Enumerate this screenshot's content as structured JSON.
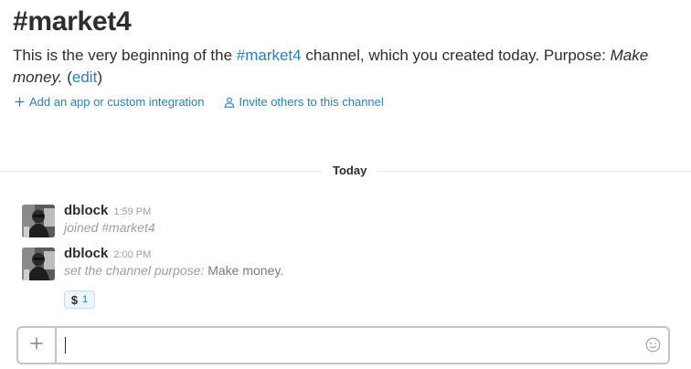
{
  "channel": {
    "title": "#market4",
    "intro_prefix": "This is the very beginning of the ",
    "intro_channel_link": "#market4",
    "intro_middle": " channel, which you created today. Purpose: ",
    "purpose": "Make money.",
    "edit_open": " (",
    "edit_label": "edit",
    "edit_close": ")"
  },
  "actions": {
    "add_integration": "Add an app or custom integration",
    "invite_others": "Invite others to this channel"
  },
  "divider": {
    "label": "Today"
  },
  "messages": [
    {
      "sender": "dblock",
      "time": "1:59 PM",
      "text": "joined #market4"
    },
    {
      "sender": "dblock",
      "time": "2:00 PM",
      "text_prefix": "set the channel purpose: ",
      "text_value": "Make money.",
      "reaction": {
        "emoji": "$",
        "count": "1"
      }
    }
  ],
  "composer": {
    "value": "",
    "placeholder": ""
  },
  "colors": {
    "link": "#2a80b9",
    "text": "#2c2d30",
    "muted": "#9e9ea6",
    "border": "#c5c5c8"
  },
  "icons": {
    "add_integration": "plus-icon",
    "invite": "person-icon",
    "composer_add": "plus-icon",
    "composer_emoji": "smiley-icon"
  }
}
